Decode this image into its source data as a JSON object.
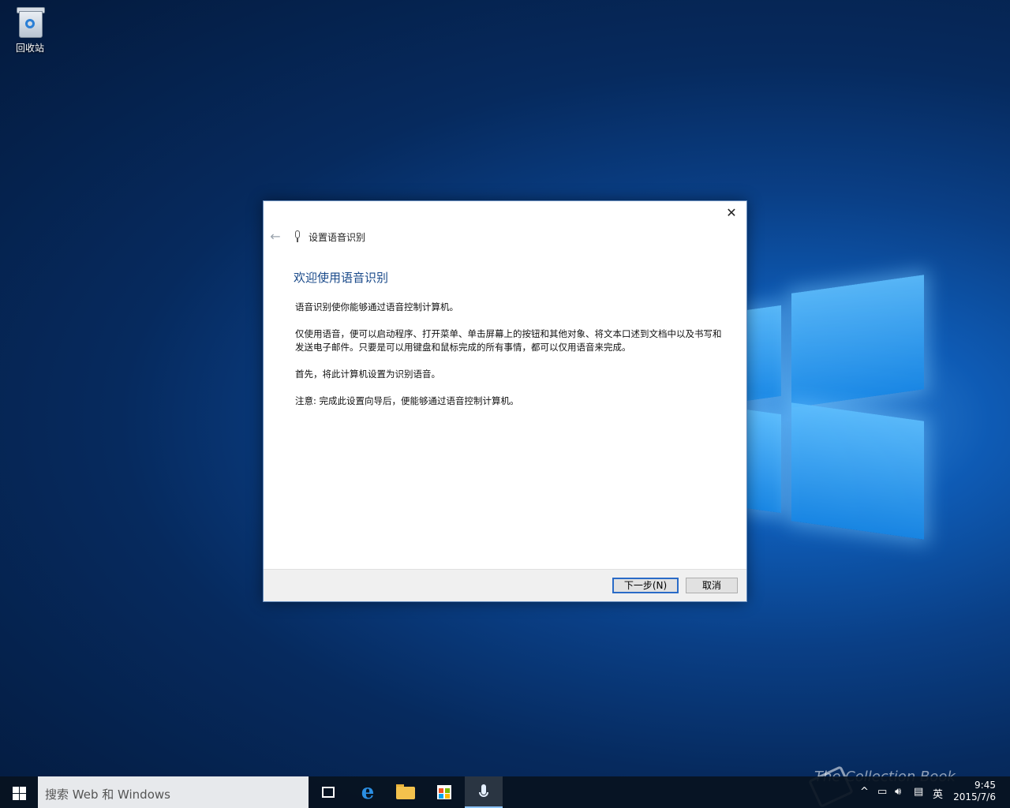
{
  "desktop": {
    "icons": [
      {
        "label": "回收站",
        "icon": "recycle-bin-icon"
      }
    ]
  },
  "dialog": {
    "nav_title": "设置语音识别",
    "heading": "欢迎使用语音识别",
    "paragraphs": [
      "语音识别使你能够通过语音控制计算机。",
      "仅使用语音，便可以启动程序、打开菜单、单击屏幕上的按钮和其他对象、将文本口述到文档中以及书写和发送电子邮件。只要是可以用键盘和鼠标完成的所有事情，都可以仅用语音来完成。",
      "首先，将此计算机设置为识别语音。",
      "注意: 完成此设置向导后，便能够通过语音控制计算机。"
    ],
    "buttons": {
      "next": "下一步(N)",
      "cancel": "取消"
    },
    "close_glyph": "✕",
    "back_glyph": "←"
  },
  "taskbar": {
    "search_placeholder": "搜索 Web 和 Windows",
    "pinned": [
      "task-view-icon",
      "edge-icon",
      "file-explorer-icon",
      "store-icon",
      "speech-recognition-icon"
    ],
    "tray": {
      "chevron": "^",
      "ime": "英"
    },
    "clock": {
      "time": "9:45",
      "date": "2015/7/6"
    }
  },
  "watermark": "The Collection Book",
  "colors": {
    "accent": "#2a6bc7",
    "heading": "#1a4a8a",
    "taskbar": "#08121f"
  }
}
